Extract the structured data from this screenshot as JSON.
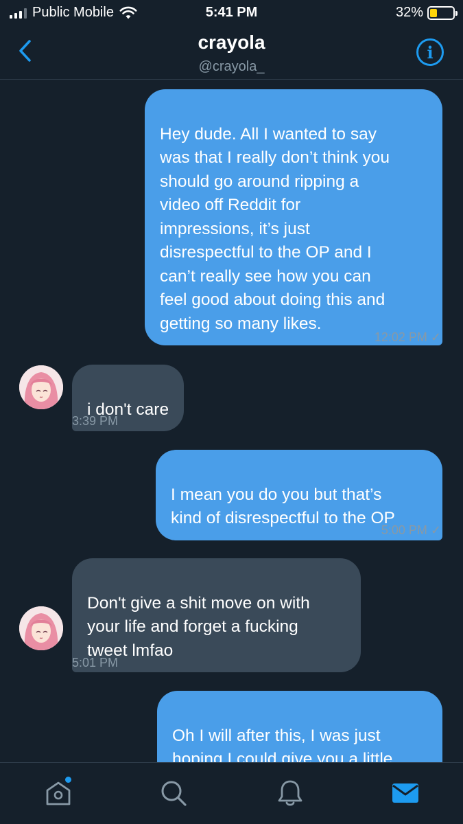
{
  "status_bar": {
    "carrier": "Public Mobile",
    "time": "5:41 PM",
    "battery": "32%",
    "battery_level": 0.32
  },
  "header": {
    "name": "crayola",
    "handle": "@crayola_"
  },
  "messages": [
    {
      "from": "me",
      "text": "Hey dude. All I wanted to say\nwas that I really don’t think you\nshould go around ripping a\nvideo off Reddit for\nimpressions, it’s just\ndisrespectful to the OP and I\ncan’t really see how you can\nfeel good about doing this and\ngetting so many likes.",
      "time": "12:02 PM ✓"
    },
    {
      "from": "them",
      "text": "i don't care",
      "time": "3:39 PM"
    },
    {
      "from": "me",
      "text": "I mean you do you but that’s\nkind of disrespectful to the OP",
      "time": "5:00 PM ✓"
    },
    {
      "from": "them",
      "text": "Don't give a shit move on with\nyour life and forget a fucking\ntweet lmfao",
      "time": "5:01 PM"
    },
    {
      "from": "me",
      "text": "Oh I will after this, I was just\nhoping I could give you a little\ntip for later",
      "time": ""
    }
  ],
  "tabs": [
    {
      "name": "home-icon",
      "has_notification": true
    },
    {
      "name": "search-icon",
      "has_notification": false
    },
    {
      "name": "bell-icon",
      "has_notification": false
    },
    {
      "name": "mail-icon",
      "active": true
    }
  ],
  "colors": {
    "background": "#15202b",
    "sent_bubble": "#4a9ee9",
    "received_bubble": "#3a4a59",
    "accent": "#1d9bf0",
    "muted_text": "#8899a6"
  }
}
